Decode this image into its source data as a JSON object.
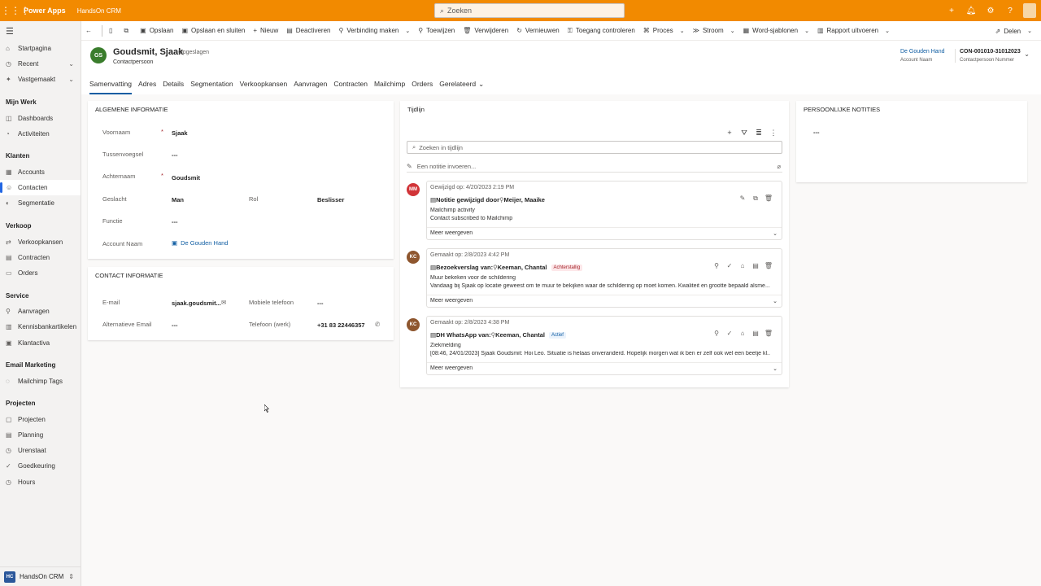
{
  "topbar": {
    "brand": "Power Apps",
    "app": "HandsOn CRM",
    "search_placeholder": "Zoeken"
  },
  "sidebar": {
    "pinned": [
      {
        "label": "Startpagina",
        "icon": "home-icon",
        "chev": false
      },
      {
        "label": "Recent",
        "icon": "clock-icon",
        "chev": true
      },
      {
        "label": "Vastgemaakt",
        "icon": "pin-icon",
        "chev": true
      }
    ],
    "groups": [
      {
        "title": "Mijn Werk",
        "items": [
          "Dashboards",
          "Activiteiten"
        ]
      },
      {
        "title": "Klanten",
        "items": [
          "Accounts",
          "Contacten",
          "Segmentatie"
        ]
      },
      {
        "title": "Verkoop",
        "items": [
          "Verkoopkansen",
          "Contracten",
          "Orders"
        ]
      },
      {
        "title": "Service",
        "items": [
          "Aanvragen",
          "Kennisbankartikelen",
          "Klantactiva"
        ]
      },
      {
        "title": "Email Marketing",
        "items": [
          "Mailchimp Tags"
        ]
      },
      {
        "title": "Projecten",
        "items": [
          "Projecten",
          "Planning",
          "Urenstaat",
          "Goedkeuring",
          "Hours"
        ]
      }
    ],
    "active_item": "Contacten",
    "app_badge": "HC",
    "app_name": "HandsOn CRM"
  },
  "commands": [
    {
      "label": "Opslaan",
      "icon": "save-icon"
    },
    {
      "label": "Opslaan en sluiten",
      "icon": "save-close-icon"
    },
    {
      "label": "Nieuw",
      "icon": "plus-icon"
    },
    {
      "label": "Deactiveren",
      "icon": "deactivate-icon"
    },
    {
      "label": "Verbinding maken",
      "icon": "connect-icon"
    },
    {
      "label": "Toewijzen",
      "icon": "assign-icon"
    },
    {
      "label": "Verwijderen",
      "icon": "trash-icon"
    },
    {
      "label": "Vernieuwen",
      "icon": "refresh-icon"
    },
    {
      "label": "Toegang controleren",
      "icon": "key-icon"
    },
    {
      "label": "Proces",
      "icon": "process-icon"
    },
    {
      "label": "Stroom",
      "icon": "flow-icon"
    },
    {
      "label": "Word-sjablonen",
      "icon": "word-icon"
    },
    {
      "label": "Rapport uitvoeren",
      "icon": "report-icon"
    }
  ],
  "share_label": "Delen",
  "record": {
    "initials": "GS",
    "name": "Goudsmit, Sjaak",
    "saved": "- Opgeslagen",
    "type": "Contactpersoon",
    "account_value": "De Gouden Hand",
    "account_label": "Account Naam",
    "number_value": "CON-001010-31012023",
    "number_label": "Contactpersoon Nummer"
  },
  "tabs": [
    "Samenvatting",
    "Adres",
    "Details",
    "Segmentation",
    "Verkoopkansen",
    "Aanvragen",
    "Contracten",
    "Mailchimp",
    "Orders",
    "Gerelateerd"
  ],
  "general": {
    "title": "ALGEMENE INFORMATIE",
    "voornaam_label": "Voornaam",
    "voornaam": "Sjaak",
    "tussenvoegsel_label": "Tussenvoegsel",
    "tussenvoegsel": "---",
    "achternaam_label": "Achternaam",
    "achternaam": "Goudsmit",
    "geslacht_label": "Geslacht",
    "geslacht": "Man",
    "rol_label": "Rol",
    "rol": "Beslisser",
    "functie_label": "Functie",
    "functie": "---",
    "account_label": "Account Naam",
    "account": "De Gouden Hand"
  },
  "contact": {
    "title": "CONTACT INFORMATIE",
    "email_label": "E-mail",
    "email": "sjaak.goudsmit...",
    "alt_email_label": "Alternatieve Email",
    "alt_email": "---",
    "mobile_label": "Mobiele telefoon",
    "mobile": "---",
    "phone_label": "Telefoon (werk)",
    "phone": "+31 83 22446357"
  },
  "timeline": {
    "title": "Tijdlijn",
    "search_placeholder": "Zoeken in tijdlijn",
    "note_placeholder": "Een notitie invoeren...",
    "more": "Meer weergeven",
    "entries": [
      {
        "initials": "MM",
        "color": "#d13438",
        "meta": "Gewijzigd op: 4/20/2023 2:19 PM",
        "title": "Notitie gewijzigd door",
        "person": "Meijer, Maaike",
        "badge": "",
        "line1": "Mailchimp activity",
        "line2": "Contact subscribed to Mailchimp"
      },
      {
        "initials": "KC",
        "color": "#8e562e",
        "meta": "Gemaakt op: 2/8/2023 4:42 PM",
        "title": "Bezoekverslag van:",
        "person": "Keeman, Chantal",
        "badge": "Achterstallig",
        "line1": "Muur bekeken voor de schildering",
        "line2": "Vandaag bij Sjaak op locatie geweest om te muur te bekijken waar de schildering op moet komen. Kwaliteit en grootte bepaald alsme..."
      },
      {
        "initials": "KC",
        "color": "#8e562e",
        "meta": "Gemaakt op: 2/8/2023 4:38 PM",
        "title": "DH WhatsApp van:",
        "person": "Keeman, Chantal",
        "badge": "Actief",
        "line1": "Ziekmelding",
        "line2": "[08:46, 24/01/2023] Sjaak Goudsmit: Hoi Leo. Situatie is helaas onveranderd. Hopelijk morgen wat ik ben er zelf ook wel een beetje kl..."
      }
    ]
  },
  "notes": {
    "title": "PERSOONLIJKE NOTITIES",
    "value": "---"
  }
}
